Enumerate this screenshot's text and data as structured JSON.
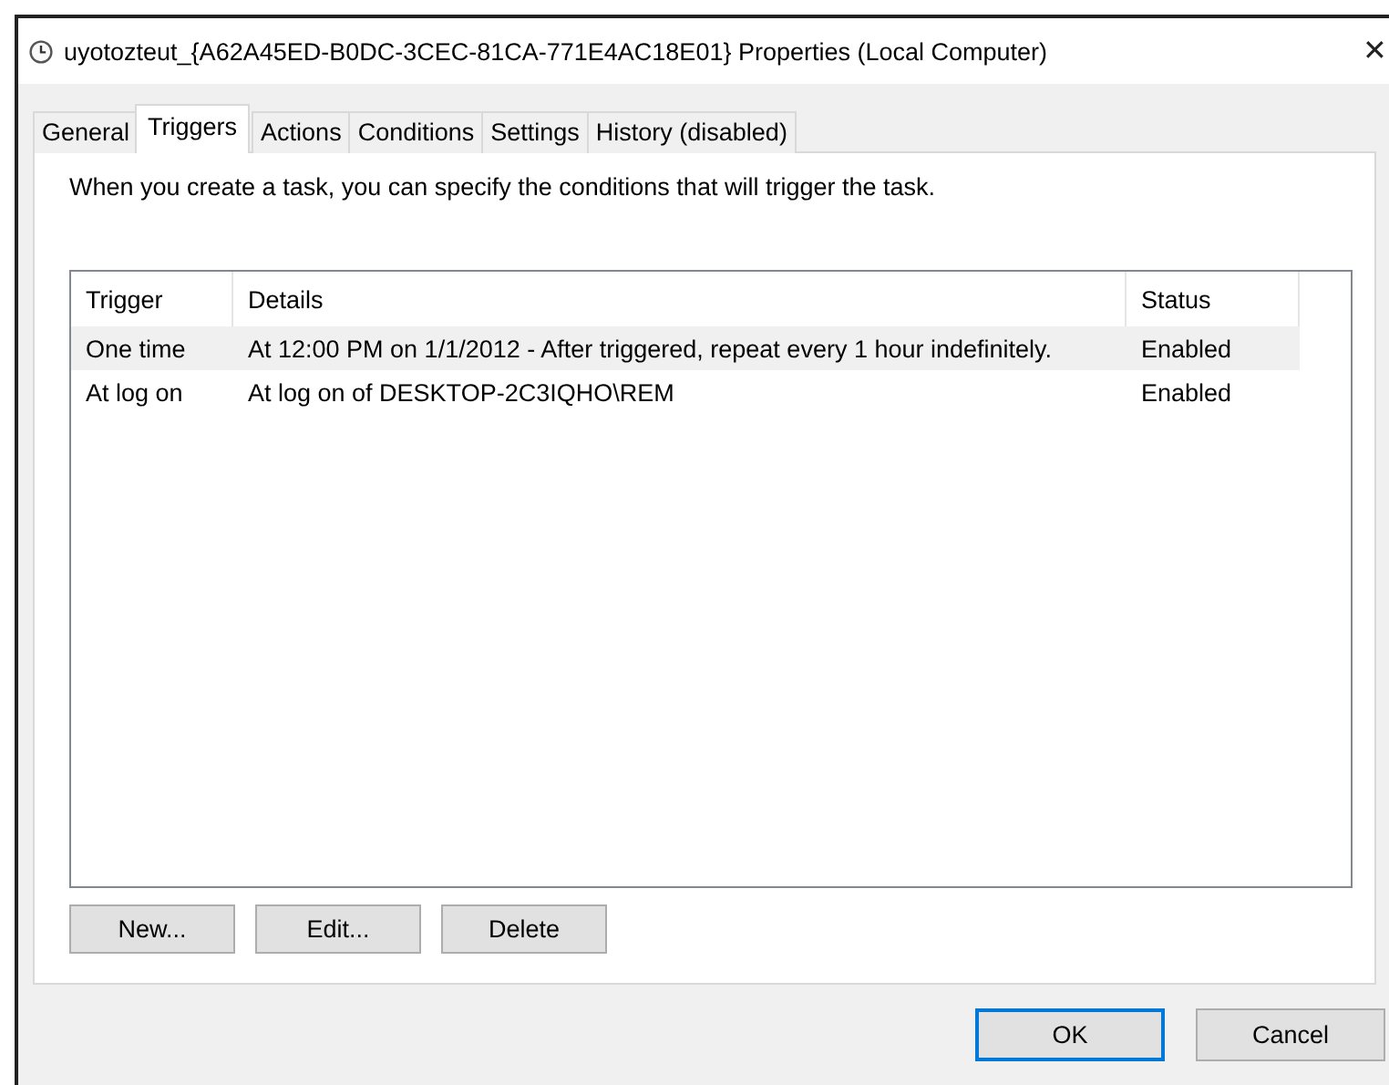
{
  "window": {
    "title": "uyotozteut_{A62A45ED-B0DC-3CEC-81CA-771E4AC18E01} Properties (Local Computer)",
    "close": "✕"
  },
  "tabs": [
    {
      "label": "General",
      "selected": false
    },
    {
      "label": "Triggers",
      "selected": true
    },
    {
      "label": "Actions",
      "selected": false
    },
    {
      "label": "Conditions",
      "selected": false
    },
    {
      "label": "Settings",
      "selected": false
    },
    {
      "label": "History (disabled)",
      "selected": false
    }
  ],
  "description": "When you create a task, you can specify the conditions that will trigger the task.",
  "table": {
    "columns": [
      "Trigger",
      "Details",
      "Status"
    ],
    "rows": [
      {
        "cells": [
          "One time",
          "At 12:00 PM on 1/1/2012 - After triggered, repeat every 1 hour indefinitely.",
          "Enabled"
        ],
        "selected": true
      },
      {
        "cells": [
          "At log on",
          "At log on of DESKTOP-2C3IQHO\\REM",
          "Enabled"
        ],
        "selected": false
      }
    ]
  },
  "list_buttons": [
    "New...",
    "Edit...",
    "Delete"
  ],
  "dialog_buttons": [
    {
      "label": "OK",
      "default": true
    },
    {
      "label": "Cancel",
      "default": false
    }
  ]
}
